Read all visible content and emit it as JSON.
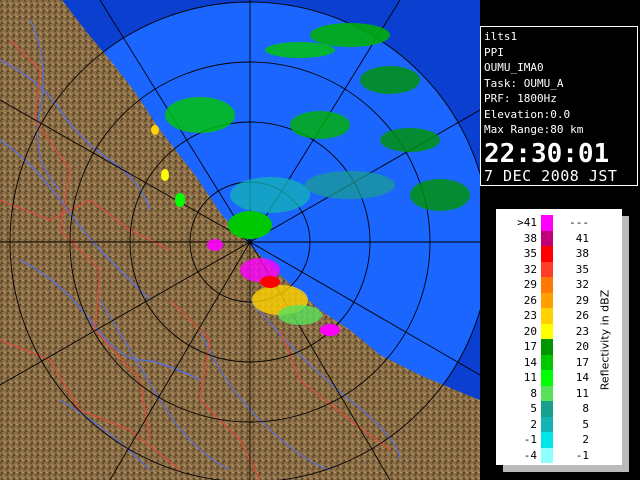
{
  "info": {
    "radar": "ilts1",
    "product": "PPI",
    "site": "OUMU_IMA0",
    "task": "Task: OUMU_A",
    "prf": "PRF: 1800Hz",
    "elevation": "Elevation:0.0",
    "max_range": "Max Range:80 km",
    "time": "22:30:01",
    "date": "7 DEC 2008 JST"
  },
  "legend": {
    "title": "Reflectivity in dBZ",
    "bins": [
      {
        "low": ">41",
        "high": "---",
        "color": "#ff00ff"
      },
      {
        "low": "38",
        "high": "41",
        "color": "#c0007a"
      },
      {
        "low": "35",
        "high": "38",
        "color": "#ff0000"
      },
      {
        "low": "32",
        "high": "35",
        "color": "#ff3c28"
      },
      {
        "low": "29",
        "high": "32",
        "color": "#ff7800"
      },
      {
        "low": "26",
        "high": "29",
        "color": "#ffa000"
      },
      {
        "low": "23",
        "high": "26",
        "color": "#ffd200"
      },
      {
        "low": "20",
        "high": "23",
        "color": "#ffff00"
      },
      {
        "low": "17",
        "high": "20",
        "color": "#009600"
      },
      {
        "low": "14",
        "high": "17",
        "color": "#00c800"
      },
      {
        "low": "11",
        "high": "14",
        "color": "#00ff00"
      },
      {
        "low": "8",
        "high": "11",
        "color": "#5ae15a"
      },
      {
        "low": "5",
        "high": "8",
        "color": "#19a08c"
      },
      {
        "low": "2",
        "high": "5",
        "color": "#14b4b4"
      },
      {
        "low": "-1",
        "high": "2",
        "color": "#00e6e6"
      },
      {
        "low": "-4",
        "high": "-1",
        "color": "#8cffff"
      }
    ]
  },
  "map": {
    "ocean_color": "#0b4fd8",
    "range_disc_color": "#1a66ff",
    "land_color": "#8a6d45"
  }
}
